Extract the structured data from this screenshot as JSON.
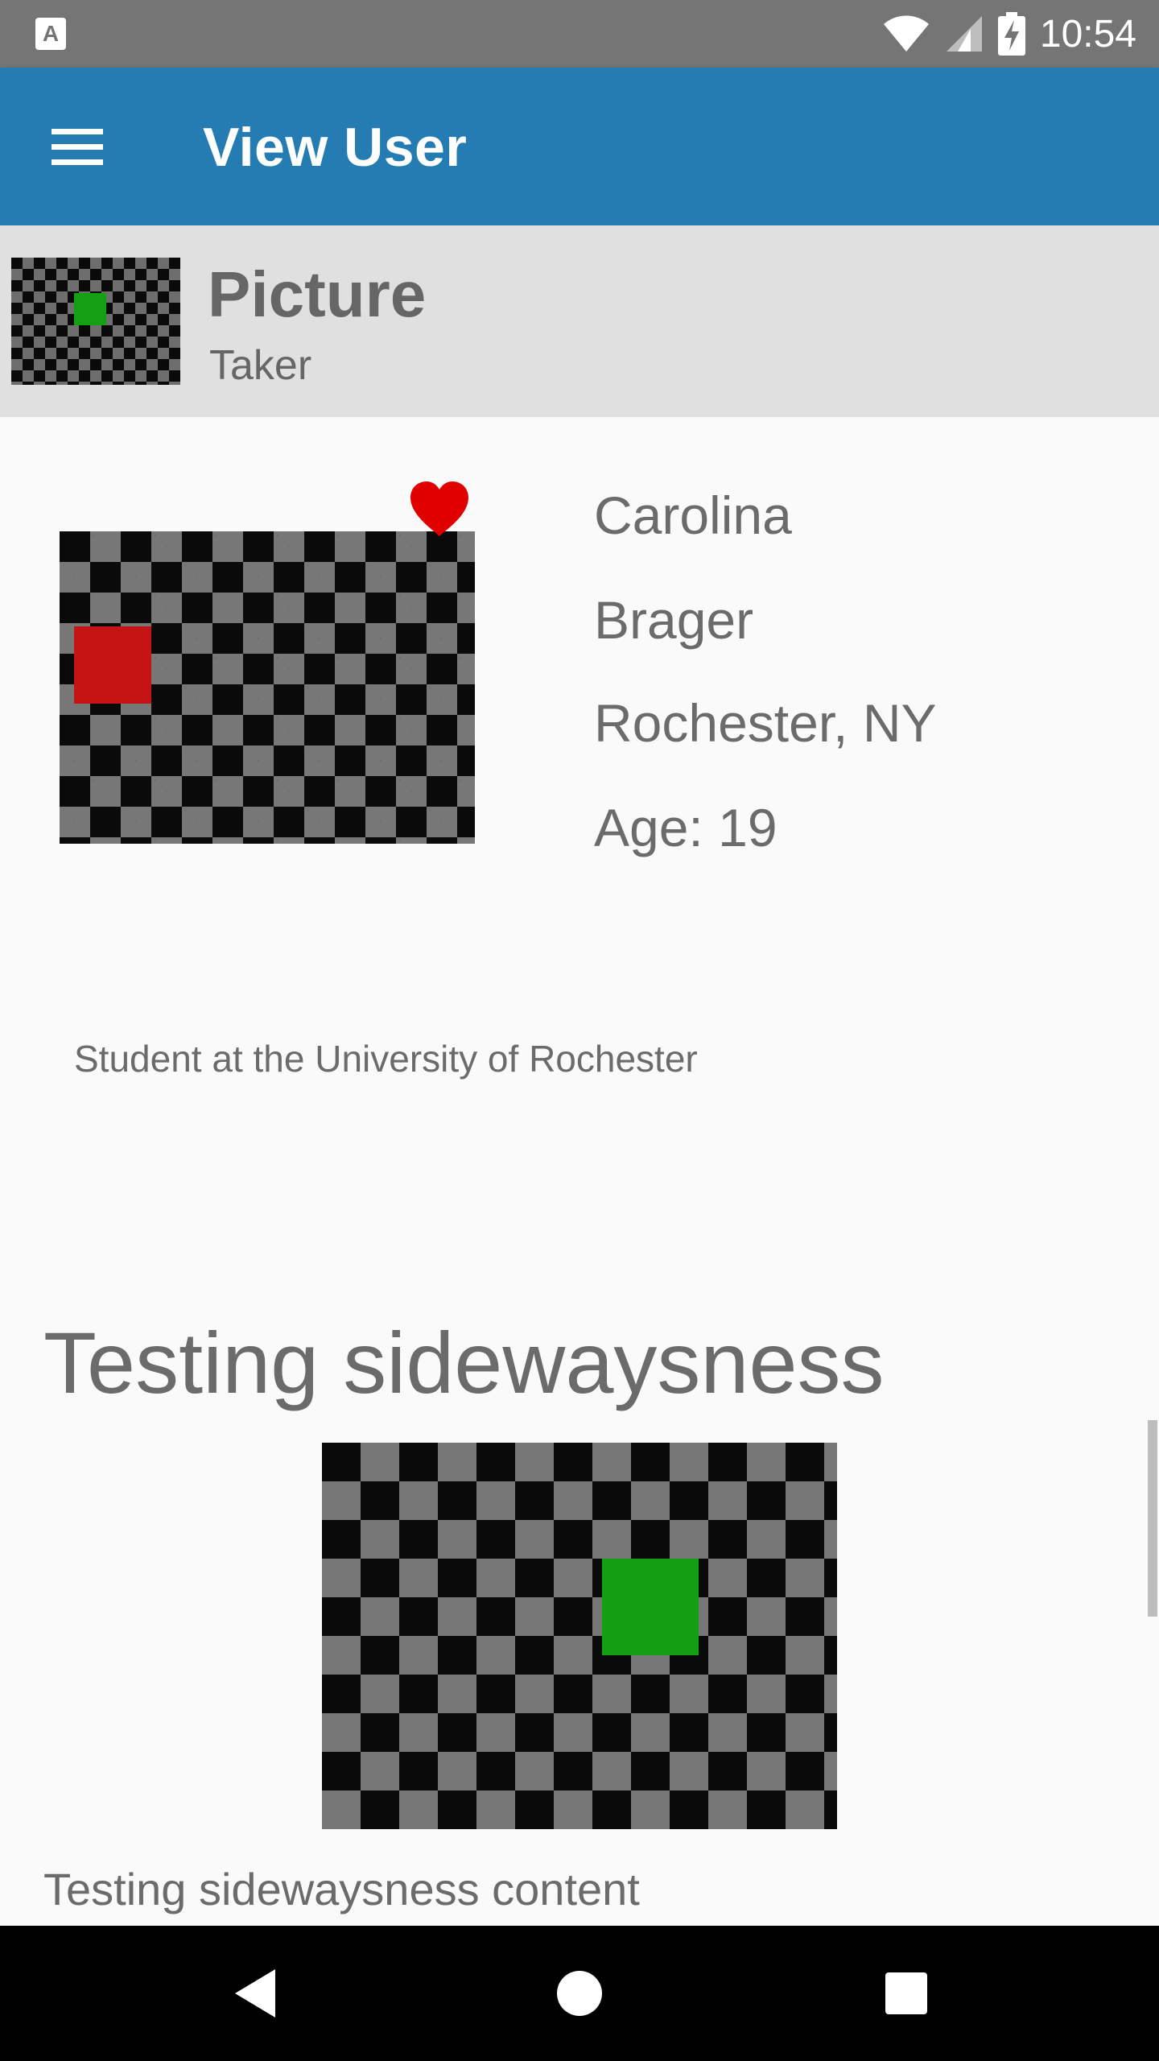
{
  "status_bar": {
    "time": "10:54",
    "left_icon": "keyboard-a-icon",
    "left_icon_letter": "A",
    "icons": [
      "wifi-icon",
      "signal-icon",
      "battery-charging-icon"
    ]
  },
  "app_bar": {
    "title": "View User",
    "menu_icon": "hamburger-menu-icon",
    "color": "#247cb2"
  },
  "header": {
    "title": "Picture",
    "subtitle": "Taker"
  },
  "profile": {
    "first_name": "Carolina",
    "last_name": "Brager",
    "location": "Rochester, NY",
    "age": "Age: 19",
    "bio": "Student at the University of Rochester",
    "favorite_icon": "heart-icon",
    "favorite_color": "#e00000"
  },
  "section": {
    "heading": "Testing sidewaysness",
    "content": "Testing sidewaysness content"
  },
  "nav_bar": {
    "back_icon": "back-triangle-icon",
    "home_icon": "home-circle-icon",
    "recents_icon": "recents-square-icon"
  }
}
